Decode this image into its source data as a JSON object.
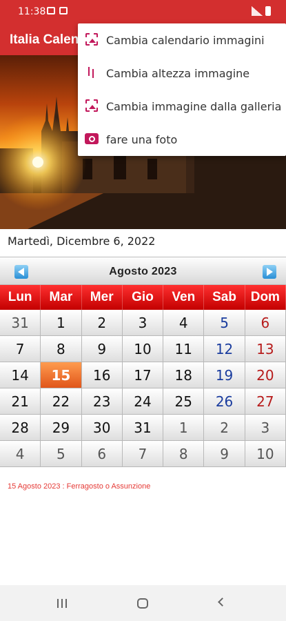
{
  "status": {
    "time": "11:38"
  },
  "app": {
    "title": "Italia Calendario"
  },
  "date_line": "Martedì, Dicembre 6, 2022",
  "calendar": {
    "month": "Agosto  2023",
    "weekdays": [
      "Lun",
      "Mar",
      "Mer",
      "Gio",
      "Ven",
      "Sab",
      "Dom"
    ],
    "days": [
      "31",
      "1",
      "2",
      "3",
      "4",
      "5",
      "6",
      "7",
      "8",
      "9",
      "10",
      "11",
      "12",
      "13",
      "14",
      "15",
      "16",
      "17",
      "18",
      "19",
      "20",
      "21",
      "22",
      "23",
      "24",
      "25",
      "26",
      "27",
      "28",
      "29",
      "30",
      "31",
      "1",
      "2",
      "3",
      "4",
      "5",
      "6",
      "7",
      "8",
      "9",
      "10"
    ],
    "today": "15"
  },
  "holiday": "15 Agosto 2023 : Ferragosto o Assunzione",
  "menu": {
    "items": [
      {
        "label": "Cambia calendario immagini",
        "icon": "image-icon"
      },
      {
        "label": "Cambia altezza immagine",
        "icon": "height-icon"
      },
      {
        "label": "Cambia immagine dalla galleria",
        "icon": "gallery-icon"
      },
      {
        "label": "fare una foto",
        "icon": "camera-icon"
      }
    ]
  },
  "colors": {
    "primary": "#d32f2f",
    "accent": "#c2185b",
    "today": "#e0551a",
    "saturday": "#1a3c9e",
    "sunday": "#b71c1c"
  }
}
